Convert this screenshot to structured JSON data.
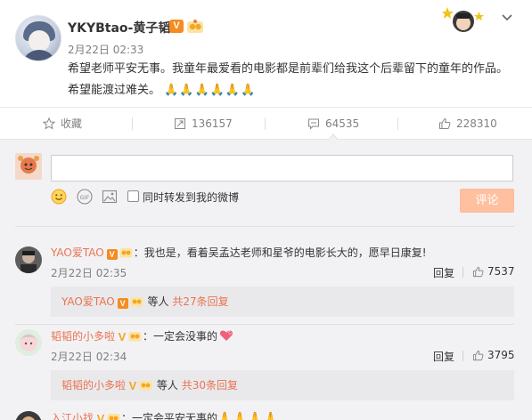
{
  "post": {
    "username": "YKYBtao-黄子韬",
    "time": "2月22日 02:33",
    "text": "希望老师平安无事。我童年最爱看的电影都是前辈们给我这个后辈留下的童年的作品。希望能渡过难关。",
    "emoji": "🙏🙏🙏🙏🙏🙏",
    "vip_badge": "V"
  },
  "actions": {
    "favorite_label": "收藏",
    "repost_count": "136157",
    "comment_count": "64535",
    "like_count": "228310"
  },
  "compose": {
    "input_value": "",
    "repost_label": "同时转发到我的微博",
    "submit_label": "评论"
  },
  "comments": [
    {
      "name": "YAO爱TAO",
      "badge": "V",
      "text": "：我也是，看着吴孟达老师和星爷的电影长大的，愿早日康复!",
      "time": "2月22日 02:35",
      "reply_label": "回复",
      "likes": "7537",
      "sub_name": "YAO爱TAO",
      "sub_mid": "等人",
      "sub_count": "共27条回复"
    },
    {
      "name": "韬韬的小多啦",
      "badge": "V",
      "text": "：一定会没事的",
      "time": "2月22日 02:34",
      "reply_label": "回复",
      "likes": "3795",
      "sub_name": "韬韬的小多啦",
      "sub_mid": "等人",
      "sub_count": "共30条回复"
    },
    {
      "name": "入江小找",
      "badge": "V",
      "text": "：一定会平安无事的",
      "emoji": "🙏🙏🙏🙏"
    }
  ],
  "colors": {
    "accent": "#eb7350",
    "submit_bg": "#ffc09f",
    "badge_orange": "#f68b1f"
  }
}
